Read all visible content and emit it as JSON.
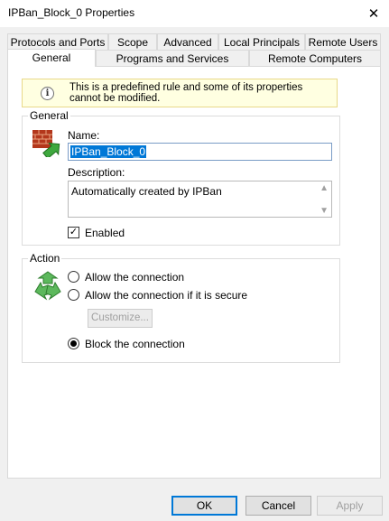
{
  "window": {
    "title": "IPBan_Block_0 Properties",
    "close_symbol": "✕"
  },
  "tabs": {
    "row1": [
      "Protocols and Ports",
      "Scope",
      "Advanced",
      "Local Principals",
      "Remote Users"
    ],
    "row2": [
      "General",
      "Programs and Services",
      "Remote Computers"
    ],
    "selected": "General"
  },
  "banner": {
    "icon": "info-icon",
    "glyph": "i",
    "text": "This is a predefined rule and some of its properties cannot be modified."
  },
  "general_group": {
    "label": "General",
    "name_label": "Name:",
    "name_value": "IPBan_Block_0",
    "description_label": "Description:",
    "description_value": "Automatically created by IPBan",
    "enabled_label": "Enabled",
    "enabled_checked": true,
    "check_glyph": "✓"
  },
  "action_group": {
    "label": "Action",
    "options": [
      "Allow the connection",
      "Allow the connection if it is secure",
      "Block the connection"
    ],
    "selected": "Block the connection",
    "customize_label": "Customize..."
  },
  "buttons": {
    "ok": "OK",
    "cancel": "Cancel",
    "apply": "Apply"
  }
}
